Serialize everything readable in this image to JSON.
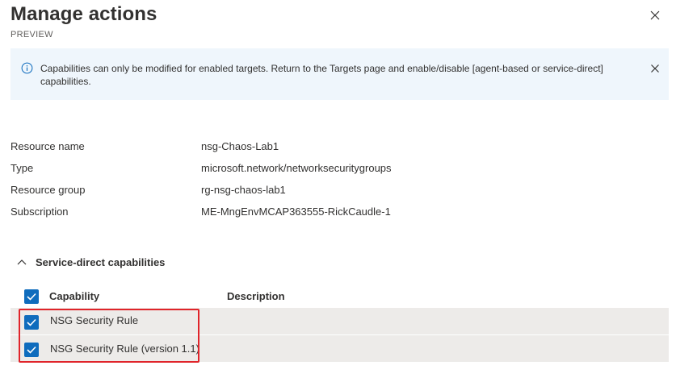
{
  "panel": {
    "title": "Manage actions",
    "subtitle": "PREVIEW"
  },
  "info_bar": {
    "message": "Capabilities can only be modified for enabled targets. Return to the Targets page and enable/disable [agent-based or service-direct] capabilities."
  },
  "properties": [
    {
      "label": "Resource name",
      "value": "nsg-Chaos-Lab1"
    },
    {
      "label": "Type",
      "value": "microsoft.network/networksecuritygroups"
    },
    {
      "label": "Resource group",
      "value": "rg-nsg-chaos-lab1"
    },
    {
      "label": "Subscription",
      "value": "ME-MngEnvMCAP363555-RickCaudle-1"
    }
  ],
  "section": {
    "title": "Service-direct capabilities",
    "expanded": true
  },
  "table": {
    "columns": {
      "capability": "Capability",
      "description": "Description"
    },
    "select_all_checked": true,
    "rows": [
      {
        "capability": "NSG Security Rule",
        "description": "",
        "checked": true
      },
      {
        "capability": "NSG Security Rule (version 1.1)",
        "description": "",
        "checked": true
      }
    ]
  },
  "colors": {
    "accent": "#0f6cbd",
    "info_background": "#eff6fc",
    "row_background": "#edebe9",
    "highlight_border": "#e0242a"
  }
}
